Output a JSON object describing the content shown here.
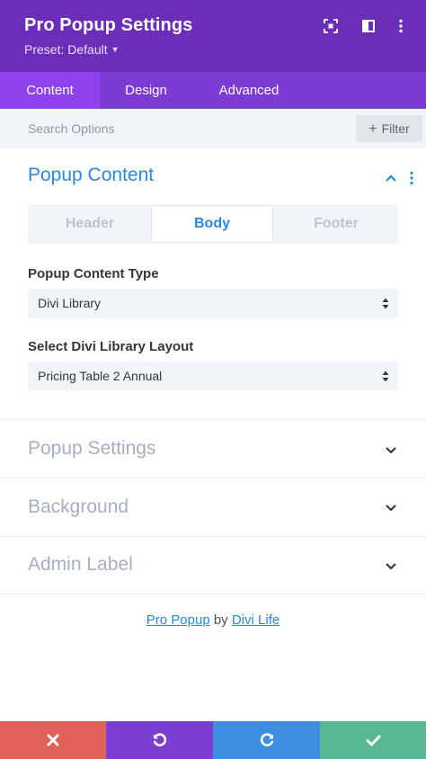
{
  "header": {
    "title": "Pro Popup Settings",
    "preset": "Preset: Default",
    "icons": [
      "focus-icon",
      "sidebar-toggle-icon",
      "more-vertical-icon"
    ]
  },
  "tabs": [
    {
      "label": "Content",
      "active": true
    },
    {
      "label": "Design",
      "active": false
    },
    {
      "label": "Advanced",
      "active": false
    }
  ],
  "search": {
    "placeholder": "Search Options",
    "filter_label": "Filter"
  },
  "sections": {
    "popup_content": {
      "title": "Popup Content",
      "expanded": true,
      "subtabs": [
        {
          "label": "Header",
          "active": false
        },
        {
          "label": "Body",
          "active": true
        },
        {
          "label": "Footer",
          "active": false
        }
      ],
      "fields": [
        {
          "label": "Popup Content Type",
          "value": "Divi Library"
        },
        {
          "label": "Select Divi Library Layout",
          "value": "Pricing Table 2 Annual"
        }
      ]
    },
    "popup_settings": {
      "title": "Popup Settings",
      "expanded": false
    },
    "background": {
      "title": "Background",
      "expanded": false
    },
    "admin_label": {
      "title": "Admin Label",
      "expanded": false
    }
  },
  "credits": {
    "link1": "Pro Popup",
    "by": "by",
    "link2": "Divi Life"
  },
  "footer_buttons": [
    {
      "name": "discard",
      "icon": "close-icon",
      "color": "#e0605a"
    },
    {
      "name": "undo",
      "icon": "undo-icon",
      "color": "#7b3ed0"
    },
    {
      "name": "redo",
      "icon": "redo-icon",
      "color": "#3e8ee0"
    },
    {
      "name": "save",
      "icon": "check-icon",
      "color": "#59b894"
    }
  ],
  "colors": {
    "header_bg": "#6c2eb9",
    "tabs_bg": "#7c3bd3",
    "active_tab_bg": "#8f42ec",
    "accent": "#2b87da"
  }
}
